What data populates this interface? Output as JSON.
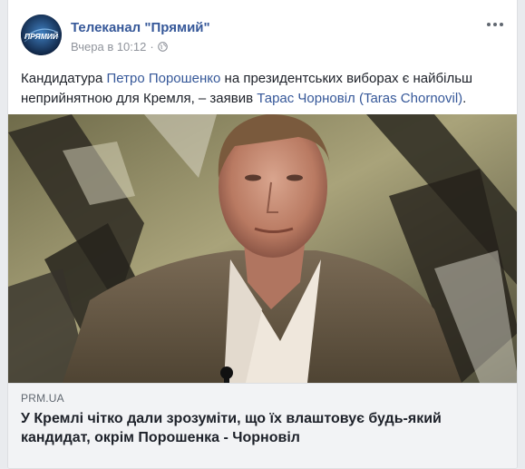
{
  "post": {
    "page_name": "Телеканал \"Прямий\"",
    "timestamp": "Вчера в 10:12",
    "privacy_icon": "globe-icon",
    "more_icon": "more-options-icon",
    "avatar_text": "ПРЯМИЙ",
    "text": {
      "part1": "Кандидатура ",
      "link1": "Петро Порошенко",
      "part2": " на президентських виборах є найбільш неприйнятною для Кремля, – заявив ",
      "link2": "Тарас Чорновіл (Taras Chornovil)",
      "part3": "."
    }
  },
  "link_preview": {
    "domain": "PRM.UA",
    "headline": "У Кремлі чітко дали зрозуміти, що їх влаштовує будь-який кандидат, окрім Порошенка - Чорновіл"
  },
  "colors": {
    "link": "#365899",
    "text": "#1d2129",
    "meta": "#90949c",
    "background": "#e9ebee"
  }
}
